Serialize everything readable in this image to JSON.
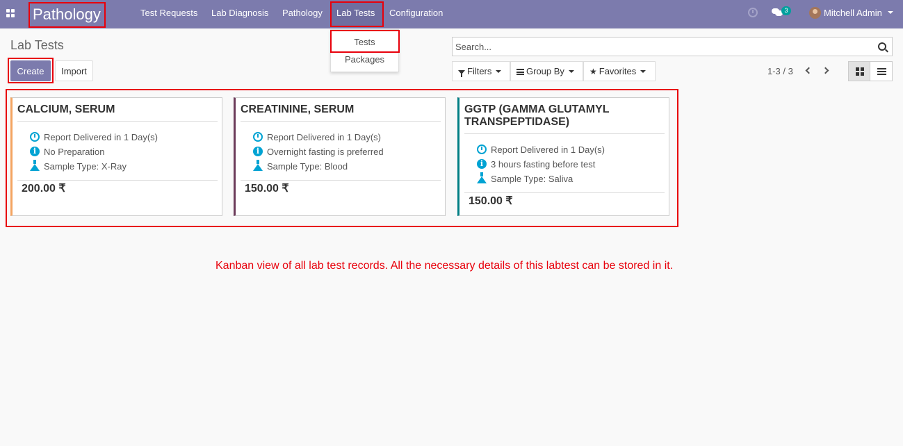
{
  "navbar": {
    "brand": "Pathology",
    "menu": [
      "Test Requests",
      "Lab Diagnosis",
      "Pathology",
      "Lab Tests",
      "Configuration"
    ],
    "chat_count": "3",
    "user_name": "Mitchell Admin"
  },
  "dropdown": {
    "items": [
      "Tests",
      "Packages"
    ]
  },
  "control_panel": {
    "title": "Lab Tests",
    "create_label": "Create",
    "import_label": "Import",
    "search_placeholder": "Search...",
    "filters_label": "Filters",
    "group_by_label": "Group By",
    "favorites_label": "Favorites",
    "pager": "1-3 / 3"
  },
  "cards": [
    {
      "title": "CALCIUM, SERUM",
      "report": "Report Delivered in 1 Day(s)",
      "preparation": "No Preparation",
      "sample": "Sample Type: X-Ray",
      "price": "200.00 ₹",
      "color": "#f4a460"
    },
    {
      "title": "CREATININE, SERUM",
      "report": "Report Delivered in 1 Day(s)",
      "preparation": "Overnight fasting is preferred",
      "sample": "Sample Type: Blood",
      "price": "150.00 ₹",
      "color": "#6c3b5a"
    },
    {
      "title": "GGTP (GAMMA GLUTAMYL TRANSPEPTIDASE)",
      "report": "Report Delivered in 1 Day(s)",
      "preparation": "3 hours fasting before test",
      "sample": "Sample Type: Saliva",
      "price": "150.00 ₹",
      "color": "#017e84"
    }
  ],
  "caption": "Kanban view of all lab test records. All the necessary details of this labtest can be stored in it.",
  "colors": {
    "navbar": "#7c7bad",
    "highlight": "#e8000b",
    "icon": "#00a3d3"
  }
}
